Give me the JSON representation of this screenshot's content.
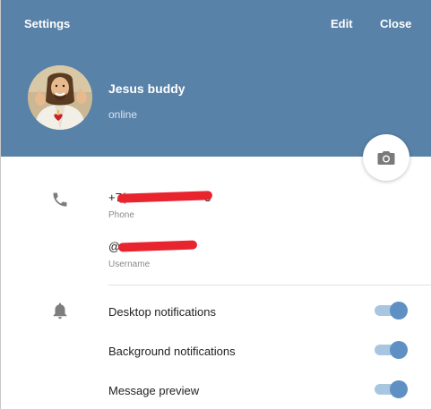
{
  "header": {
    "title": "Settings",
    "edit_label": "Edit",
    "close_label": "Close",
    "background_color": "#5882a8"
  },
  "profile": {
    "name": "Jesus buddy",
    "status": "online"
  },
  "info": {
    "phone_value_visible": "+7(",
    "phone_value_suffix": "3",
    "phone_label": "Phone",
    "username_value_visible": "@",
    "username_label": "Username",
    "redaction_color": "#e8242e"
  },
  "notifications": [
    {
      "label": "Desktop notifications",
      "enabled": true
    },
    {
      "label": "Background notifications",
      "enabled": true
    },
    {
      "label": "Message preview",
      "enabled": true
    }
  ],
  "icons": {
    "phone": "phone-icon",
    "bell": "bell-icon",
    "camera": "camera-icon"
  }
}
